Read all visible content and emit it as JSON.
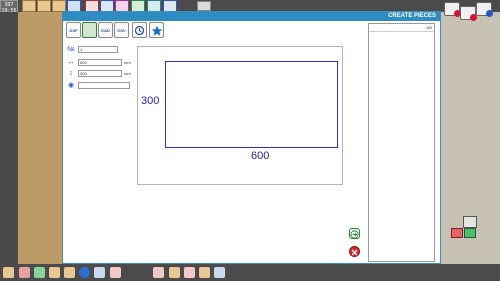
{
  "app": {
    "logo_text": "3D7",
    "clock": "10:56"
  },
  "dialog": {
    "title": "CREATE PIECES",
    "toolbar": [
      {
        "name": "dxf-import",
        "label": "DXF"
      },
      {
        "name": "draw-piece",
        "label": ""
      },
      {
        "name": "cad-import",
        "label": "CAD"
      },
      {
        "name": "csv-import",
        "label": "CSV"
      },
      {
        "name": "history",
        "label": ""
      },
      {
        "name": "favorites",
        "label": ""
      }
    ],
    "form": {
      "quantity": {
        "value": "1"
      },
      "width": {
        "value": "600",
        "unit": "mm"
      },
      "height": {
        "value": "300",
        "unit": "mm"
      },
      "label": {
        "value": ""
      }
    },
    "preview": {
      "width_label": "600",
      "height_label": "300"
    },
    "list": {
      "count": "0/0"
    }
  },
  "colors": {
    "title_bar": "#2f8cc2",
    "outline": "#2d2dc8",
    "dimension_text": "#2525aa"
  }
}
